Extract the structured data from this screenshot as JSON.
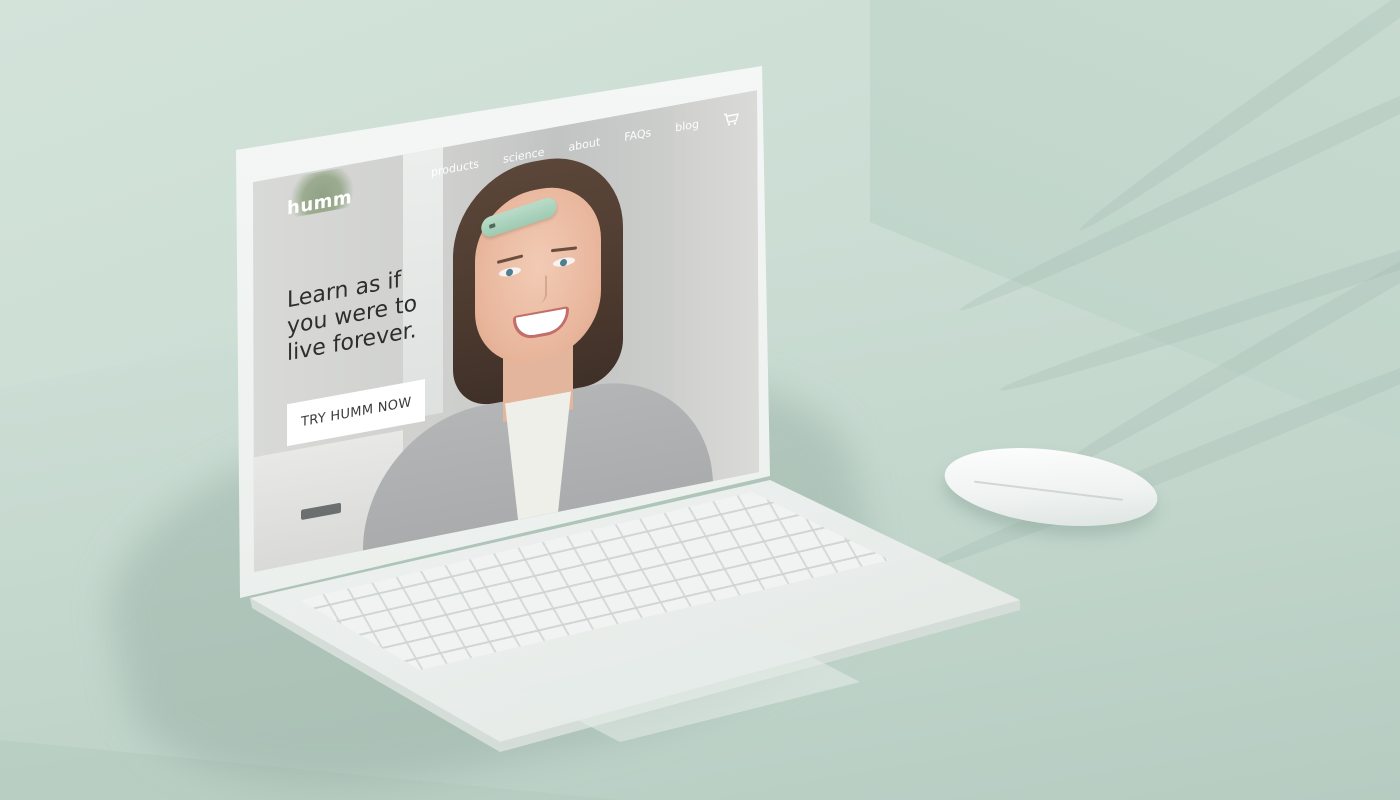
{
  "site": {
    "logo": "humm",
    "nav": {
      "items": [
        "products",
        "science",
        "about",
        "FAQs",
        "blog"
      ],
      "cart_icon": "cart-icon"
    },
    "hero": {
      "headline_line1": "Learn as if",
      "headline_line2": "you were to",
      "headline_line3": "live forever.",
      "cta_label": "TRY HUMM NOW"
    }
  },
  "colors": {
    "background": "#c9dbd1",
    "device_accent": "#9fcab2",
    "cta_background": "#ffffff"
  }
}
